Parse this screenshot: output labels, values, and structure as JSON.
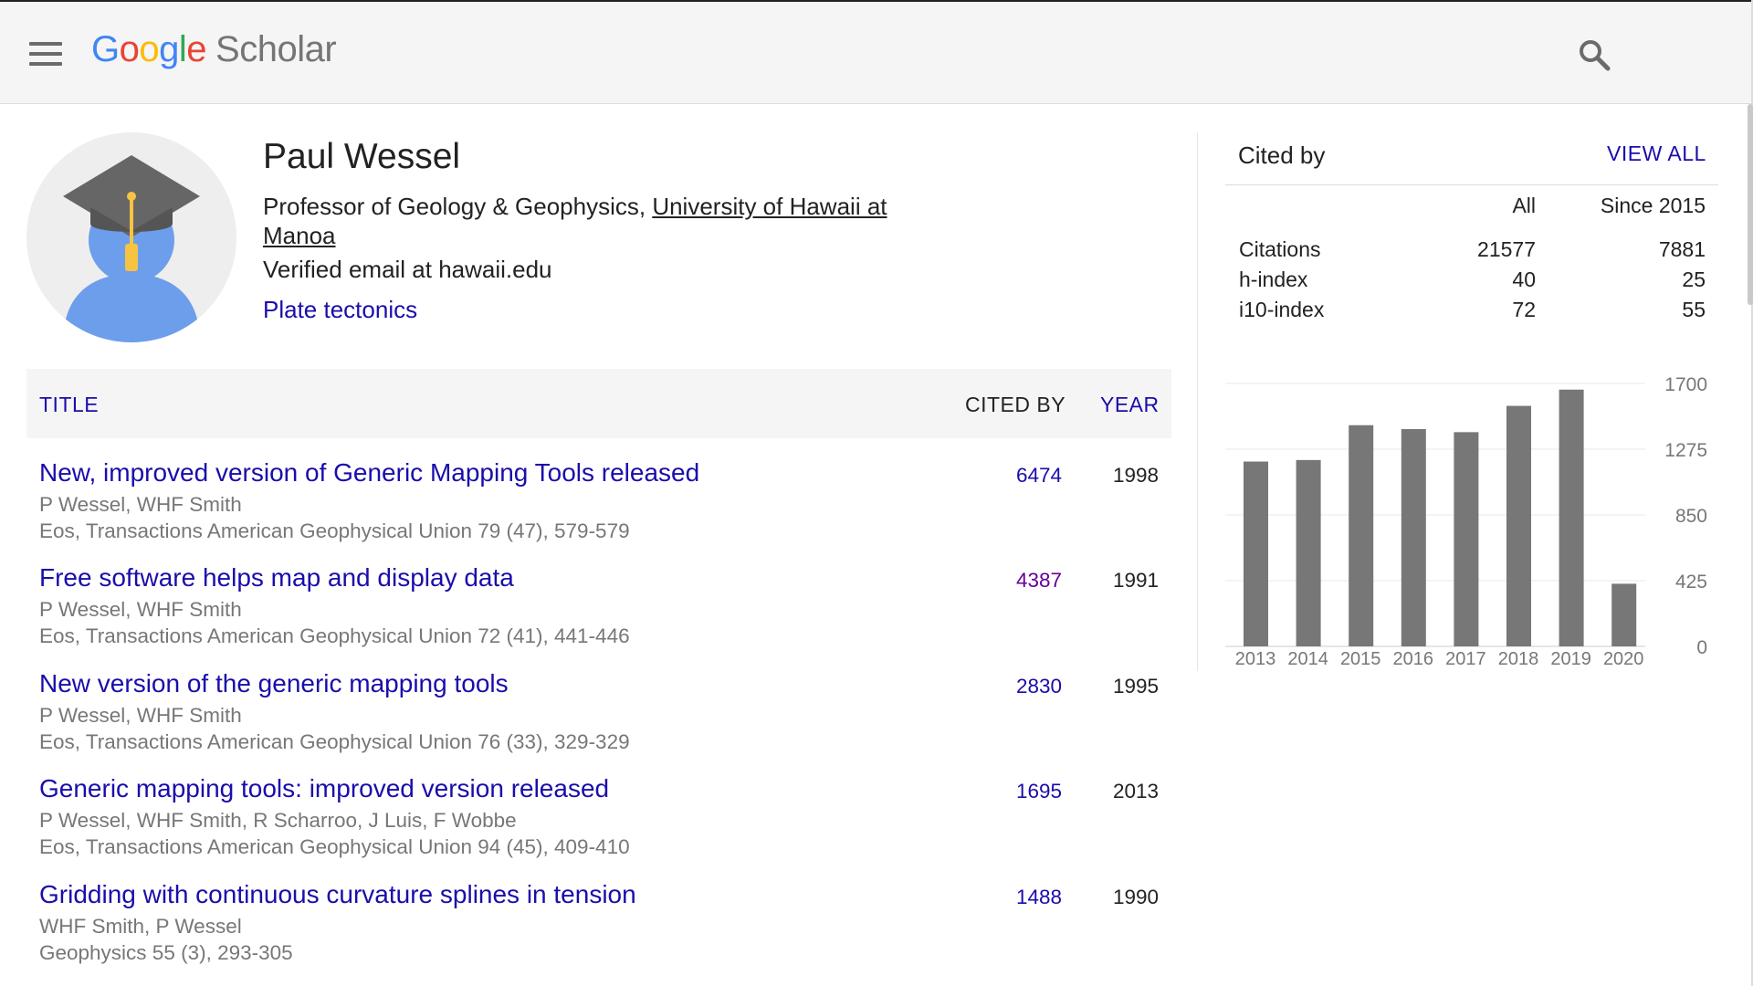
{
  "header": {
    "logo_letters": [
      "G",
      "o",
      "o",
      "g",
      "l",
      "e"
    ],
    "logo_suffix": "Scholar"
  },
  "profile": {
    "name": "Paul Wessel",
    "affiliation_prefix": "Professor of Geology & Geophysics, ",
    "affiliation_link": "University of Hawaii at Manoa",
    "email": "Verified email at hawaii.edu",
    "interest": "Plate tectonics"
  },
  "table": {
    "col_title": "TITLE",
    "col_cited": "CITED BY",
    "col_year": "YEAR",
    "rows": [
      {
        "title": "New, improved version of Generic Mapping Tools released",
        "authors": "P Wessel, WHF Smith",
        "venue": "Eos, Transactions American Geophysical Union 79 (47), 579-579",
        "cited": "6474",
        "year": "1998"
      },
      {
        "title": "Free software helps map and display data",
        "authors": "P Wessel, WHF Smith",
        "venue": "Eos, Transactions American Geophysical Union 72 (41), 441-446",
        "cited": "4387",
        "year": "1991"
      },
      {
        "title": "New version of the generic mapping tools",
        "authors": "P Wessel, WHF Smith",
        "venue": "Eos, Transactions American Geophysical Union 76 (33), 329-329",
        "cited": "2830",
        "year": "1995"
      },
      {
        "title": "Generic mapping tools: improved version released",
        "authors": "P Wessel, WHF Smith, R Scharroo, J Luis, F Wobbe",
        "venue": "Eos, Transactions American Geophysical Union 94 (45), 409-410",
        "cited": "1695",
        "year": "2013"
      },
      {
        "title": "Gridding with continuous curvature splines in tension",
        "authors": "WHF Smith, P Wessel",
        "venue": "Geophysics 55 (3), 293-305",
        "cited": "1488",
        "year": "1990"
      }
    ]
  },
  "cited_by": {
    "title": "Cited by",
    "view_all": "VIEW ALL",
    "col_all": "All",
    "col_since": "Since 2015",
    "stats": [
      {
        "label": "Citations",
        "all": "21577",
        "since": "7881"
      },
      {
        "label": "h-index",
        "all": "40",
        "since": "25"
      },
      {
        "label": "i10-index",
        "all": "72",
        "since": "55"
      }
    ]
  },
  "chart_data": {
    "type": "bar",
    "categories": [
      "2013",
      "2014",
      "2015",
      "2016",
      "2017",
      "2018",
      "2019",
      "2020"
    ],
    "values": [
      1195,
      1205,
      1430,
      1405,
      1385,
      1555,
      1660,
      405
    ],
    "ylim": [
      0,
      1700
    ],
    "yticks": [
      "0",
      "425",
      "850",
      "1275",
      "1700"
    ],
    "bar_color": "#777777",
    "grid": true
  }
}
